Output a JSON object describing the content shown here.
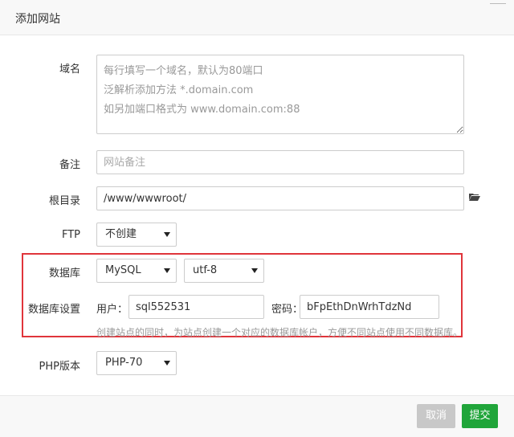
{
  "dialog": {
    "title": "添加网站"
  },
  "form": {
    "domain": {
      "label": "域名",
      "placeholder": "每行填写一个域名，默认为80端口\n泛解析添加方法 *.domain.com\n如另加端口格式为 www.domain.com:88"
    },
    "note": {
      "label": "备注",
      "placeholder": "网站备注"
    },
    "root": {
      "label": "根目录",
      "value": "/www/wwwroot/"
    },
    "ftp": {
      "label": "FTP",
      "selected": "不创建"
    },
    "database": {
      "label": "数据库",
      "type_selected": "MySQL",
      "charset_selected": "utf-8"
    },
    "db_settings": {
      "label": "数据库设置",
      "user_label": "用户：",
      "user_value": "sql552531",
      "password_label": "密码：",
      "password_value": "bFpEthDnWrhTdzNd",
      "hint": "创建站点的同时，为站点创建一个对应的数据库帐户，方便不同站点使用不同数据库。"
    },
    "php": {
      "label": "PHP版本",
      "selected": "PHP-70"
    }
  },
  "footer": {
    "cancel_label": "取消",
    "submit_label": "提交"
  },
  "colors": {
    "accent": "#20a53a",
    "highlight_border": "#e0353b",
    "cancel_bg": "#c8c8c8"
  },
  "icons": {
    "browse": "folder-open-icon",
    "dropdown": "caret-down-icon"
  }
}
